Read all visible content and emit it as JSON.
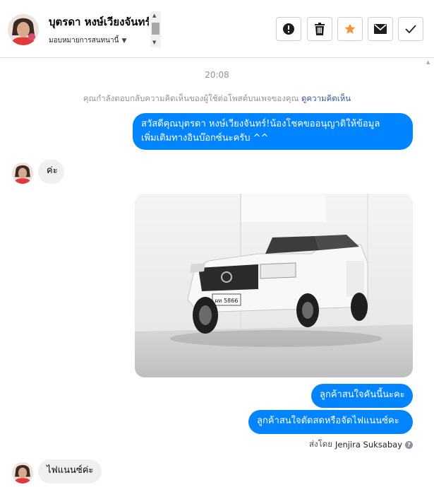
{
  "header": {
    "contact_name": "บุตรดา หงษ์เวียงจันทร์",
    "assign_label": "มอบหมายการสนทนานี้",
    "actions": [
      {
        "name": "report-button",
        "icon": "alert-icon"
      },
      {
        "name": "delete-button",
        "icon": "trash-icon"
      },
      {
        "name": "star-button",
        "icon": "star-icon"
      },
      {
        "name": "mark-unread-button",
        "icon": "envelope-icon"
      },
      {
        "name": "mark-done-button",
        "icon": "check-icon"
      }
    ]
  },
  "conversation": {
    "timestamp": "20:08",
    "notice_text": "คุณกำลังตอบกลับความคิดเห็นของผู้ใช้ต่อโพสต์บนเพจของคุณ",
    "notice_link": "ดูความคิดเห็น",
    "messages": [
      {
        "direction": "outgoing",
        "lines": [
          "สวัสดีคุณบุตรดา หงษ์เวียงจันทร์!น้องโชคขออนุญาติให้ข้อมูล",
          "เพิ่มเติมทางอินบ๊อกซ์นะครับ ^^"
        ]
      },
      {
        "direction": "incoming",
        "text": "ค่ะ"
      },
      {
        "direction": "outgoing",
        "type": "photo",
        "plate_text": "ผท 5866"
      },
      {
        "direction": "outgoing",
        "text": "ลูกค้าสนใจคันนี้นะคะ"
      },
      {
        "direction": "outgoing",
        "text": "ลูกค้าสนใจตัดสดหรือจัดไฟแนนซ์คะ"
      },
      {
        "direction": "incoming",
        "text": "ไฟแนนซ์ค่ะ"
      }
    ],
    "sent_by_label": "ส่งโดย",
    "sent_by_name": "Jenjira Suksabay"
  },
  "colors": {
    "outgoing_bubble": "#0084ff",
    "incoming_bubble": "#f1f0f0",
    "star_active": "#f7923b",
    "link": "#385898"
  }
}
